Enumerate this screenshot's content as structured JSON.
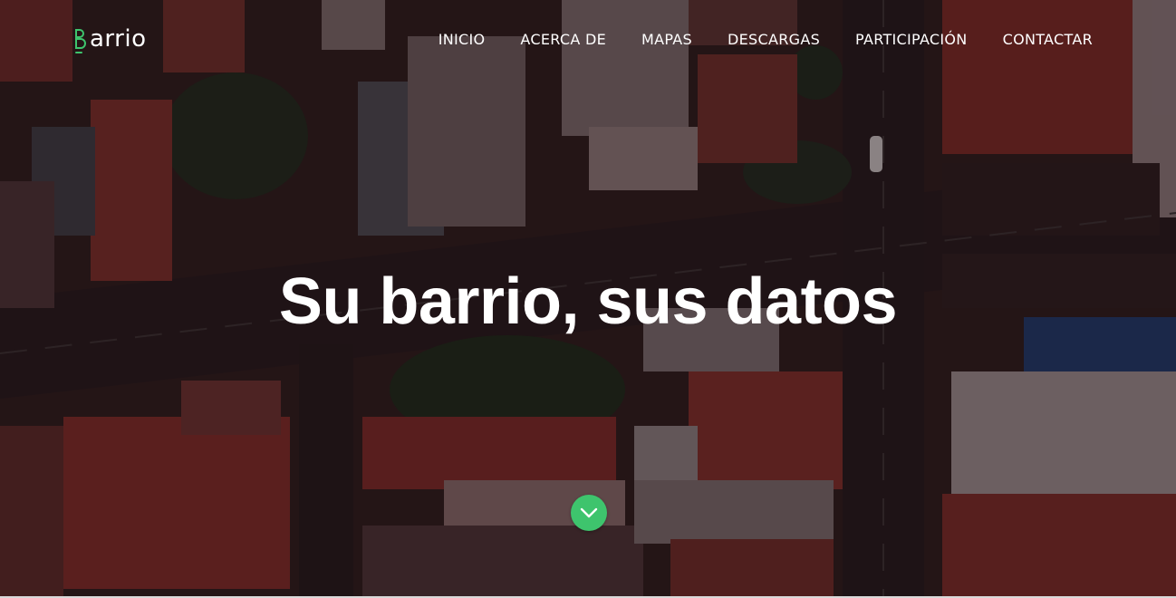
{
  "brand": {
    "logo_text": "arrio",
    "logo_icon": "barrio-b-logo-icon",
    "accent_color": "#3ec46d"
  },
  "nav": {
    "items": [
      {
        "label": "INICIO"
      },
      {
        "label": "ACERCA DE"
      },
      {
        "label": "MAPAS"
      },
      {
        "label": "DESCARGAS"
      },
      {
        "label": "PARTICIPACIÓN"
      },
      {
        "label": "CONTACTAR"
      }
    ]
  },
  "hero": {
    "headline": "Su barrio, sus datos",
    "scroll_icon": "chevron-down-icon",
    "background": "aerial-city-photo",
    "overlay_color": "#5a1a20"
  }
}
